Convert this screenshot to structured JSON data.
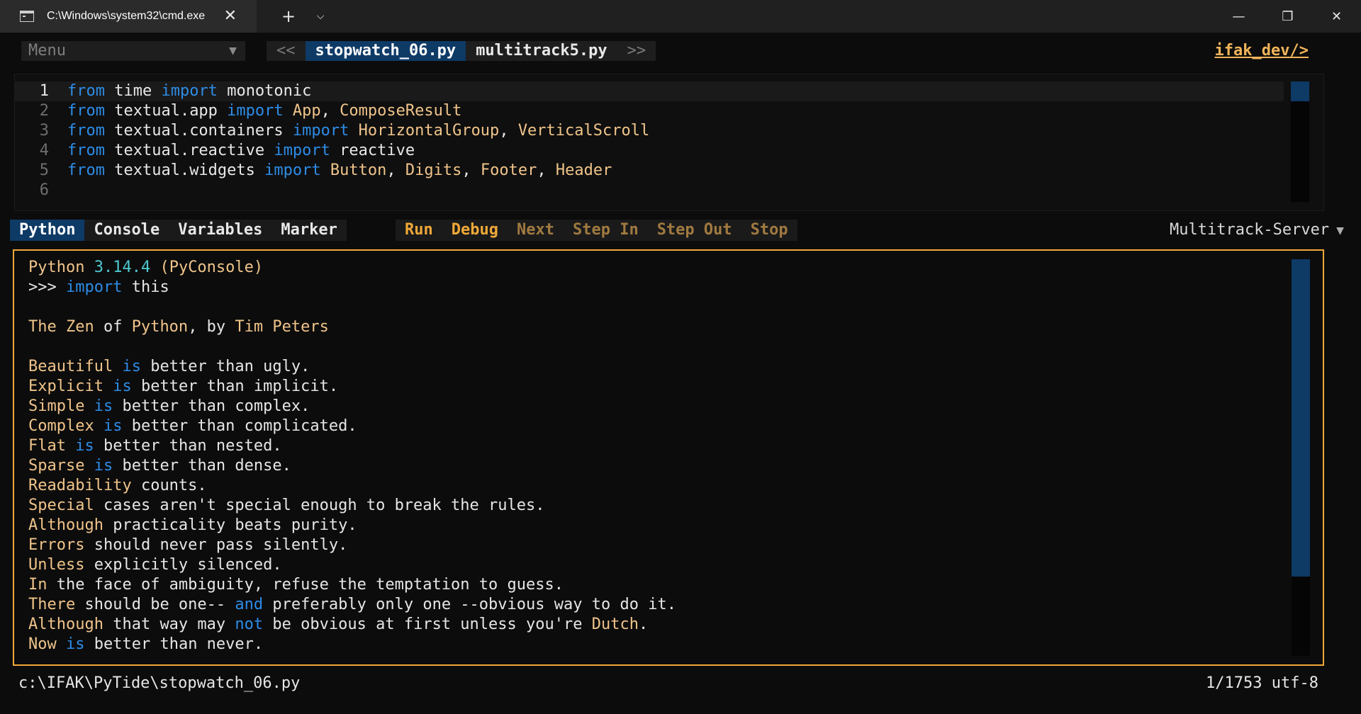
{
  "window": {
    "tab_title": "C:\\Windows\\system32\\cmd.exe",
    "tab_close": "✕",
    "new_tab": "+",
    "tab_dropdown": "⌵",
    "minimize": "—",
    "maximize": "❐",
    "close": "✕"
  },
  "topbar": {
    "menu_label": "Menu",
    "menu_arrow": "▼",
    "prev": "<<",
    "next": ">>",
    "files": [
      "stopwatch_06.py",
      "multitrack5.py"
    ],
    "brand": "ifak_dev/>"
  },
  "editor": {
    "lines": [
      {
        "n": "1",
        "tokens": [
          [
            "kw",
            "from"
          ],
          [
            "txt",
            " time "
          ],
          [
            "kw",
            "import"
          ],
          [
            "txt",
            " monotonic"
          ]
        ]
      },
      {
        "n": "2",
        "tokens": [
          [
            "kw",
            "from"
          ],
          [
            "txt",
            " textual.app "
          ],
          [
            "kw",
            "import"
          ],
          [
            "txt",
            " "
          ],
          [
            "cls",
            "App"
          ],
          [
            "txt",
            ", "
          ],
          [
            "cls",
            "ComposeResult"
          ]
        ]
      },
      {
        "n": "3",
        "tokens": [
          [
            "kw",
            "from"
          ],
          [
            "txt",
            " textual.containers "
          ],
          [
            "kw",
            "import"
          ],
          [
            "txt",
            " "
          ],
          [
            "cls",
            "HorizontalGroup"
          ],
          [
            "txt",
            ", "
          ],
          [
            "cls",
            "VerticalScroll"
          ]
        ]
      },
      {
        "n": "4",
        "tokens": [
          [
            "kw",
            "from"
          ],
          [
            "txt",
            " textual.reactive "
          ],
          [
            "kw",
            "import"
          ],
          [
            "txt",
            " reactive"
          ]
        ]
      },
      {
        "n": "5",
        "tokens": [
          [
            "kw",
            "from"
          ],
          [
            "txt",
            " textual.widgets "
          ],
          [
            "kw",
            "import"
          ],
          [
            "txt",
            " "
          ],
          [
            "cls",
            "Button"
          ],
          [
            "txt",
            ", "
          ],
          [
            "cls",
            "Digits"
          ],
          [
            "txt",
            ", "
          ],
          [
            "cls",
            "Footer"
          ],
          [
            "txt",
            ", "
          ],
          [
            "cls",
            "Header"
          ]
        ]
      },
      {
        "n": "6",
        "tokens": []
      }
    ]
  },
  "panel": {
    "tabs": [
      "Python",
      "Console",
      "Variables",
      "Marker"
    ],
    "actions": [
      {
        "label": "Run",
        "enabled": true
      },
      {
        "label": "Debug",
        "enabled": true
      },
      {
        "label": "Next",
        "enabled": false
      },
      {
        "label": "Step In",
        "enabled": false
      },
      {
        "label": "Step Out",
        "enabled": false
      },
      {
        "label": "Stop",
        "enabled": false
      }
    ],
    "server": "Multitrack-Server",
    "server_arrow": "▼"
  },
  "console": {
    "lines": [
      [
        [
          "name",
          "Python "
        ],
        [
          "num",
          "3.14.4"
        ],
        [
          "txt",
          " "
        ],
        [
          "name",
          "(PyConsole)"
        ]
      ],
      [
        [
          "txt",
          ">>> "
        ],
        [
          "kw",
          "import"
        ],
        [
          "txt",
          " this"
        ]
      ],
      [],
      [
        [
          "name",
          "The Zen"
        ],
        [
          "txt",
          " of "
        ],
        [
          "name",
          "Python"
        ],
        [
          "txt",
          ", by "
        ],
        [
          "name",
          "Tim Peters"
        ]
      ],
      [],
      [
        [
          "name",
          "Beautiful"
        ],
        [
          "txt",
          " "
        ],
        [
          "kw",
          "is"
        ],
        [
          "txt",
          " better than ugly."
        ]
      ],
      [
        [
          "name",
          "Explicit"
        ],
        [
          "txt",
          " "
        ],
        [
          "kw",
          "is"
        ],
        [
          "txt",
          " better than implicit."
        ]
      ],
      [
        [
          "name",
          "Simple"
        ],
        [
          "txt",
          " "
        ],
        [
          "kw",
          "is"
        ],
        [
          "txt",
          " better than complex."
        ]
      ],
      [
        [
          "name",
          "Complex"
        ],
        [
          "txt",
          " "
        ],
        [
          "kw",
          "is"
        ],
        [
          "txt",
          " better than complicated."
        ]
      ],
      [
        [
          "name",
          "Flat"
        ],
        [
          "txt",
          " "
        ],
        [
          "kw",
          "is"
        ],
        [
          "txt",
          " better than nested."
        ]
      ],
      [
        [
          "name",
          "Sparse"
        ],
        [
          "txt",
          " "
        ],
        [
          "kw",
          "is"
        ],
        [
          "txt",
          " better than dense."
        ]
      ],
      [
        [
          "name",
          "Readability"
        ],
        [
          "txt",
          " counts."
        ]
      ],
      [
        [
          "name",
          "Special"
        ],
        [
          "txt",
          " cases aren't special enough to break the rules."
        ]
      ],
      [
        [
          "name",
          "Although"
        ],
        [
          "txt",
          " practicality beats purity."
        ]
      ],
      [
        [
          "name",
          "Errors"
        ],
        [
          "txt",
          " should never pass silently."
        ]
      ],
      [
        [
          "name",
          "Unless"
        ],
        [
          "txt",
          " explicitly silenced."
        ]
      ],
      [
        [
          "name",
          "In"
        ],
        [
          "txt",
          " the face of ambiguity, refuse the temptation to guess."
        ]
      ],
      [
        [
          "name",
          "There"
        ],
        [
          "txt",
          " should be one-- "
        ],
        [
          "kw",
          "and"
        ],
        [
          "txt",
          " preferably only one --obvious way to do it."
        ]
      ],
      [
        [
          "name",
          "Although"
        ],
        [
          "txt",
          " that way may "
        ],
        [
          "kw",
          "not"
        ],
        [
          "txt",
          " be obvious at first unless you're "
        ],
        [
          "name",
          "Dutch"
        ],
        [
          "txt",
          "."
        ]
      ],
      [
        [
          "name",
          "Now"
        ],
        [
          "txt",
          " "
        ],
        [
          "kw",
          "is"
        ],
        [
          "txt",
          " better than never."
        ]
      ]
    ]
  },
  "status": {
    "path": "c:\\IFAK\\PyTide\\stopwatch_06.py",
    "position": "1/1753 utf-8"
  },
  "colors": {
    "accent_orange": "#f0a838",
    "keyword_blue": "#2d8ce6",
    "name_gold": "#f0c48a",
    "active_tab_blue": "#0e3a66"
  }
}
